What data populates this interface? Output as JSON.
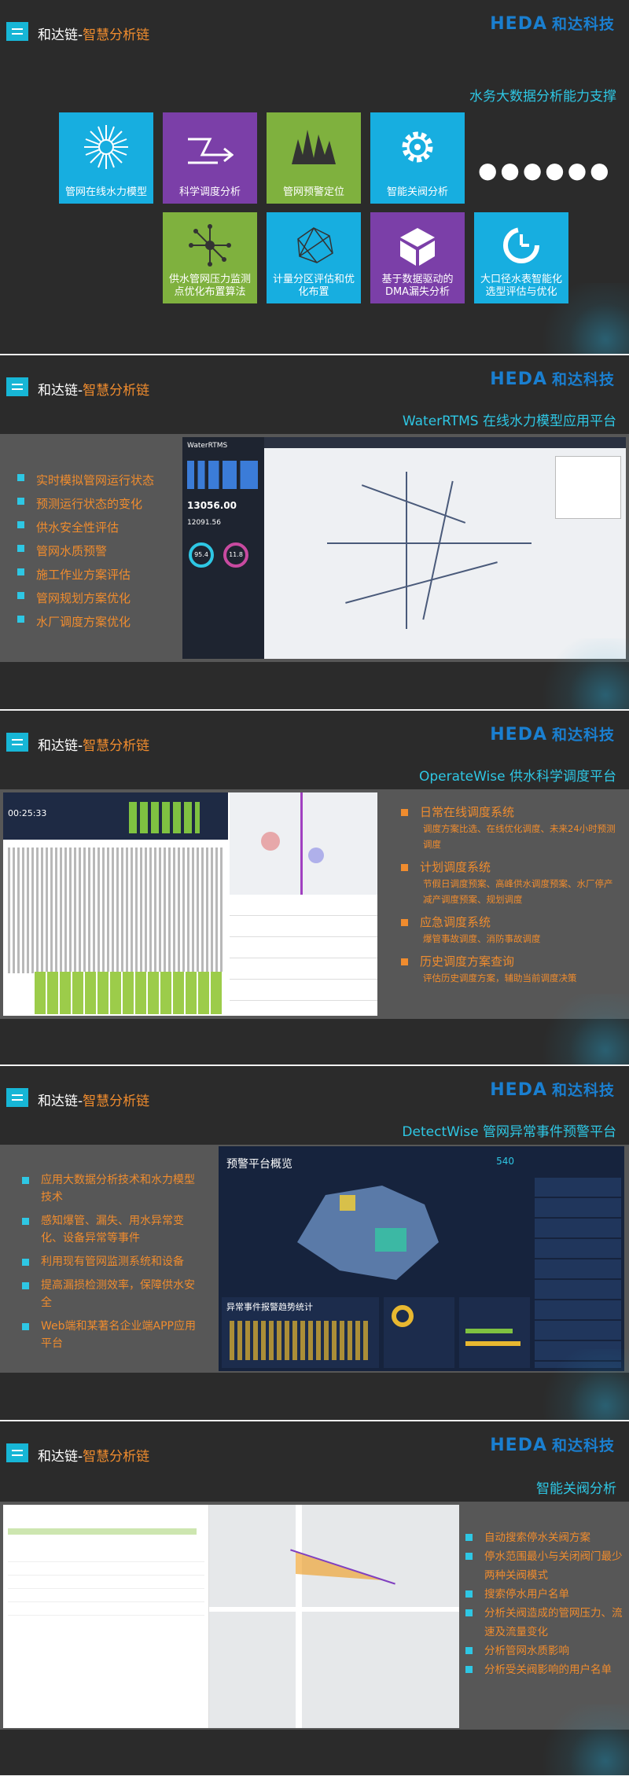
{
  "header": {
    "title_prefix": "和达链-",
    "title_accent": "智慧分析链",
    "logo_latin": "HEDA",
    "logo_cn": "和达科技"
  },
  "colors": {
    "cyan": "#17aee0",
    "purple": "#7b3fa8",
    "green": "#7fb13e",
    "orange": "#f08c2e"
  },
  "slide1": {
    "subtitle": "水务大数据分析能力支撑",
    "tiles": [
      {
        "label": "管网在线水力模型",
        "icon": "burst-icon"
      },
      {
        "label": "科学调度分析",
        "icon": "arrows-icon"
      },
      {
        "label": "管网预警定位",
        "icon": "wave-icon"
      },
      {
        "label": "智能关阀分析",
        "icon": "gear-icon"
      },
      {
        "label": "供水管网压力监测点优化布置算法",
        "icon": "network-icon"
      },
      {
        "label": "计量分区评估和优化布置",
        "icon": "mesh-icon"
      },
      {
        "label": "基于数据驱动的DMA漏失分析",
        "icon": "cube-icon"
      },
      {
        "label": "大口径水表智能化选型评估与优化",
        "icon": "timer-icon"
      }
    ],
    "dots": "●●●●●●"
  },
  "slide2": {
    "subtitle": "WaterRTMS 在线水力模型应用平台",
    "bullets": [
      "实时模拟管网运行状态",
      "预测运行状态的变化",
      "供水安全性评估",
      "管网水质预警",
      "施工作业方案评估",
      "管网规划方案优化",
      "水厂调度方案优化"
    ],
    "app_name": "WaterRTMS",
    "stat1": "13056.00",
    "stat2": "12091.56",
    "gauge1": "95.4",
    "gauge2": "11.8"
  },
  "slide3": {
    "subtitle": "OperateWise 供水科学调度平台",
    "items": [
      {
        "title": "日常在线调度系统",
        "desc": "调度方案比选、在线优化调度、未来24小时预测调度"
      },
      {
        "title": "计划调度系统",
        "desc": "节假日调度预案、高峰供水调度预案、水厂停产减产调度预案、规划调度"
      },
      {
        "title": "应急调度系统",
        "desc": "爆管事故调度、消防事故调度"
      },
      {
        "title": "历史调度方案查询",
        "desc": "评估历史调度方案，辅助当前调度决策"
      }
    ],
    "clock": "00:25:33"
  },
  "slide4": {
    "subtitle": "DetectWise 管网异常事件预警平台",
    "bullets": [
      "应用大数据分析技术和水力模型技术",
      "感知爆管、漏失、用水异常变化、设备异常等事件",
      "利用现有管网监测系统和设备",
      "提高漏损检测效率，保障供水安全",
      "Web端和某著名企业端APP应用平台"
    ],
    "screen_title": "预警平台概览",
    "chart_title": "异常事件报警趋势统计",
    "count": "540"
  },
  "slide5": {
    "subtitle": "智能关阀分析",
    "bullets": [
      "自动搜索停水关阀方案",
      "停水范围最小与关闭阀门最少两种关阀模式",
      "搜索停水用户名单",
      "分析关阀造成的管网压力、流速及流量变化",
      "分析管网水质影响",
      "分析受关阀影响的用户名单"
    ]
  }
}
